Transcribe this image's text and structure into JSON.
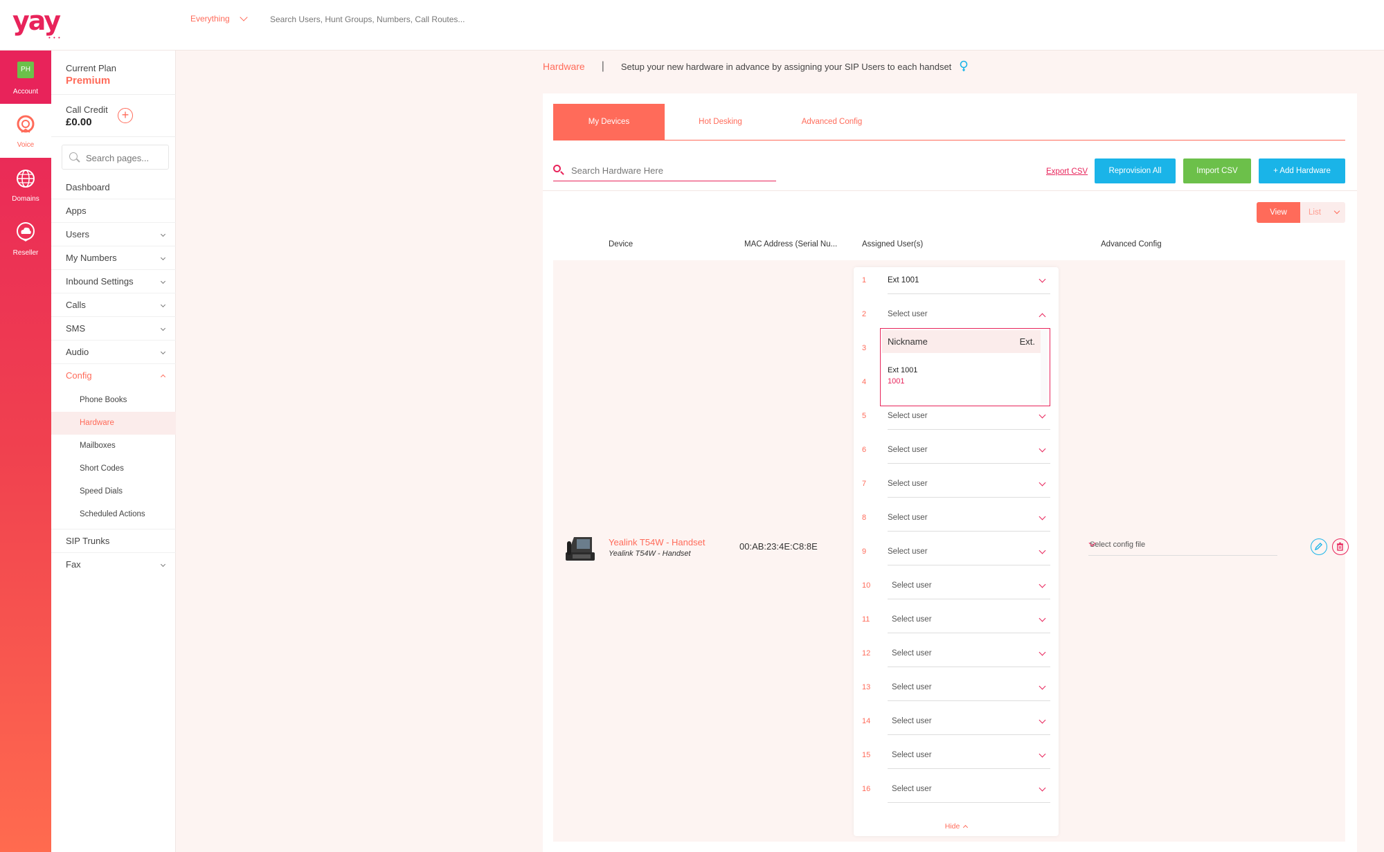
{
  "brand": {
    "logo_text": "yay",
    "accent": "#e8235a",
    "coral": "#ff6b5a"
  },
  "topbar": {
    "scope_label": "Everything",
    "search_placeholder": "Search Users, Hunt Groups, Numbers, Call Routes..."
  },
  "rail": {
    "account": {
      "initials": "PH",
      "label": "Account"
    },
    "voice": {
      "label": "Voice"
    },
    "domains": {
      "label": "Domains"
    },
    "reseller": {
      "label": "Reseller"
    }
  },
  "sidebar": {
    "plan_label": "Current Plan",
    "plan_value": "Premium",
    "credit_label": "Call Credit",
    "credit_value": "£0.00",
    "search_placeholder": "Search pages...",
    "items": [
      {
        "label": "Dashboard"
      },
      {
        "label": "Apps"
      },
      {
        "label": "Users"
      },
      {
        "label": "My Numbers"
      },
      {
        "label": "Inbound Settings"
      },
      {
        "label": "Calls"
      },
      {
        "label": "SMS"
      },
      {
        "label": "Audio"
      },
      {
        "label": "Config"
      },
      {
        "label": "SIP Trunks"
      },
      {
        "label": "Fax"
      }
    ],
    "config_sub": [
      {
        "label": "Phone Books"
      },
      {
        "label": "Hardware"
      },
      {
        "label": "Mailboxes"
      },
      {
        "label": "Short Codes"
      },
      {
        "label": "Speed Dials"
      },
      {
        "label": "Scheduled Actions"
      }
    ]
  },
  "page": {
    "title": "Hardware",
    "separator": "|",
    "description": "Setup your new hardware in advance by assigning your SIP Users to each handset"
  },
  "tabs": [
    "My Devices",
    "Hot Desking",
    "Advanced Config"
  ],
  "toolbar": {
    "search_placeholder": "Search Hardware Here",
    "export_label": "Export CSV",
    "reprovision_label": "Reprovision All",
    "import_label": "Import CSV",
    "add_label": "+ Add Hardware"
  },
  "view_toggle": {
    "view": "View",
    "list": "List"
  },
  "columns": [
    "Device",
    "MAC Address (Serial Nu...",
    "Assigned User(s)",
    "Advanced Config"
  ],
  "device": {
    "name": "Yealink T54W - Handset",
    "model": "Yealink T54W - Handset",
    "mac": "00:AB:23:4E:C8:8E",
    "config_placeholder": "Select config file"
  },
  "assigned_users": [
    {
      "n": "1",
      "value": "Ext 1001"
    },
    {
      "n": "2",
      "value": "Select user"
    },
    {
      "n": "3",
      "value": ""
    },
    {
      "n": "4",
      "value": ""
    },
    {
      "n": "5",
      "value": "Select user"
    },
    {
      "n": "6",
      "value": "Select user"
    },
    {
      "n": "7",
      "value": "Select user"
    },
    {
      "n": "8",
      "value": "Select user"
    },
    {
      "n": "9",
      "value": "Select user"
    },
    {
      "n": "10",
      "value": "Select user"
    },
    {
      "n": "11",
      "value": "Select user"
    },
    {
      "n": "12",
      "value": "Select user"
    },
    {
      "n": "13",
      "value": "Select user"
    },
    {
      "n": "14",
      "value": "Select user"
    },
    {
      "n": "15",
      "value": "Select user"
    },
    {
      "n": "16",
      "value": "Select user"
    }
  ],
  "user_dropdown": {
    "col_nickname": "Nickname",
    "col_ext": "Ext.",
    "option_name": "Ext 1001",
    "option_ext": "1001"
  },
  "hide_label": "Hide"
}
